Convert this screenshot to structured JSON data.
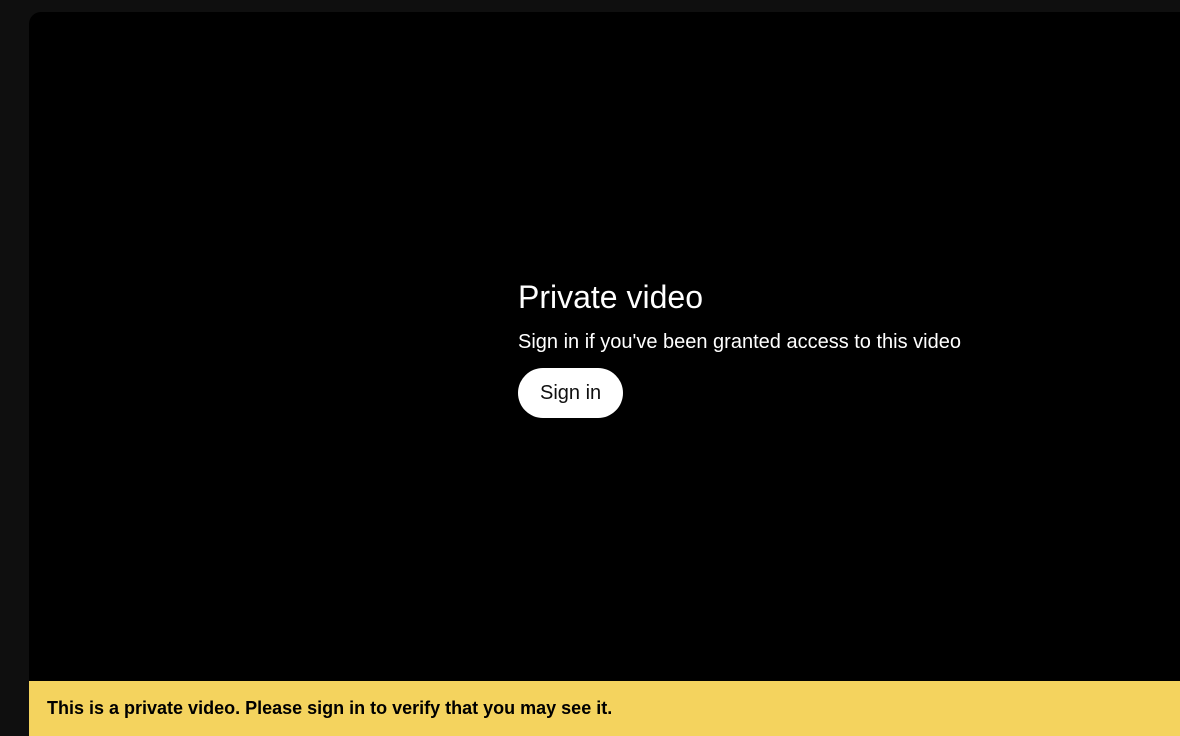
{
  "player": {
    "error": {
      "title": "Private video",
      "subtitle": "Sign in if you've been granted access to this video",
      "signin_label": "Sign in"
    }
  },
  "banner": {
    "message": "This is a private video. Please sign in to verify that you may see it."
  },
  "colors": {
    "page_background": "#0f0f0f",
    "player_background": "#000000",
    "banner_background": "#f4d35e",
    "button_background": "#ffffff"
  }
}
